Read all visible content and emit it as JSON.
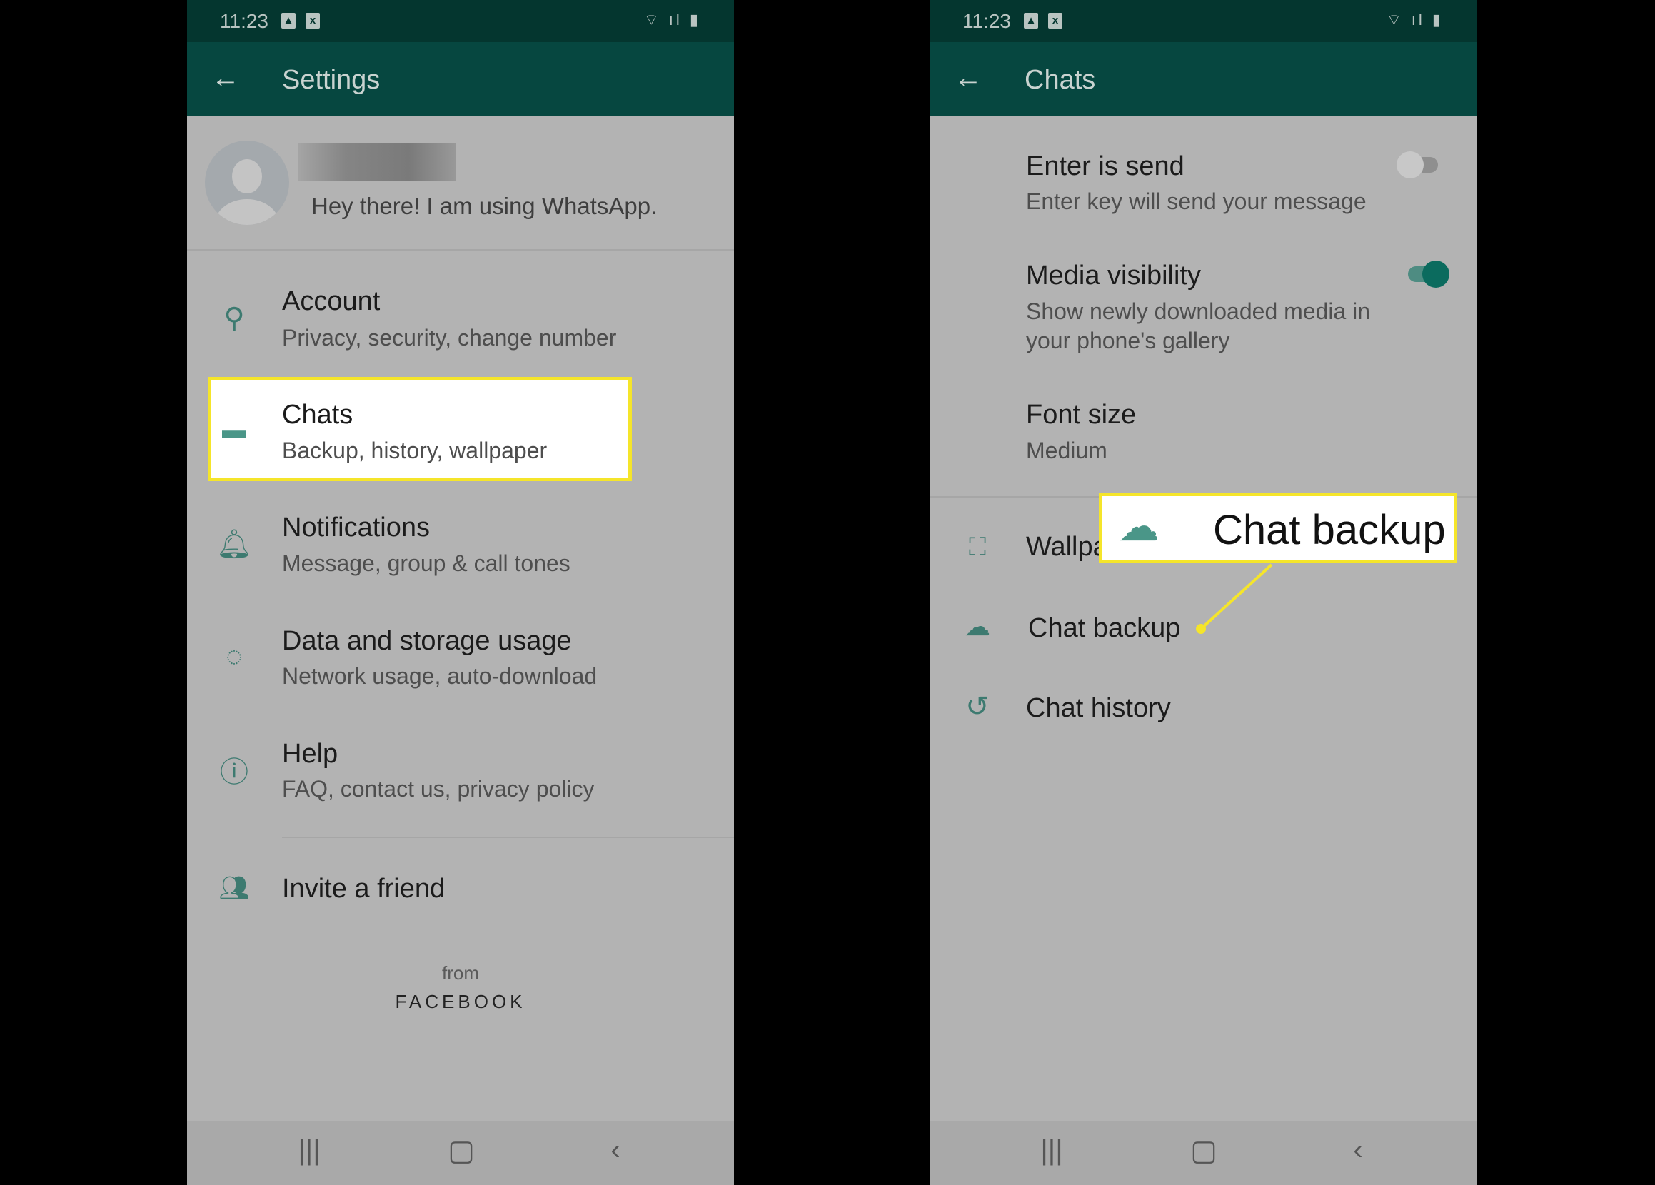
{
  "status_bar": {
    "time": "11:23"
  },
  "left": {
    "title": "Settings",
    "profile": {
      "status": "Hey there! I am using WhatsApp."
    },
    "items": [
      {
        "icon": "key-icon",
        "title": "Account",
        "subtitle": "Privacy, security, change number"
      },
      {
        "icon": "chat-icon",
        "title": "Chats",
        "subtitle": "Backup, history, wallpaper",
        "highlighted": true
      },
      {
        "icon": "bell-icon",
        "title": "Notifications",
        "subtitle": "Message, group & call tones"
      },
      {
        "icon": "data-usage-icon",
        "title": "Data and storage usage",
        "subtitle": "Network usage, auto-download"
      },
      {
        "icon": "help-icon",
        "title": "Help",
        "subtitle": "FAQ, contact us, privacy policy"
      }
    ],
    "invite": "Invite a friend",
    "footer": {
      "from": "from",
      "brand": "FACEBOOK"
    }
  },
  "right": {
    "title": "Chats",
    "enter_send": {
      "title": "Enter is send",
      "subtitle": "Enter key will send your message",
      "on": false
    },
    "media": {
      "title": "Media visibility",
      "subtitle1": "Show newly downloaded media in",
      "subtitle2": "your phone's gallery",
      "on": true
    },
    "font": {
      "title": "Font size",
      "value": "Medium"
    },
    "wallpaper": "Wallpa",
    "backup": "Chat backup",
    "history": "Chat history",
    "callout": "Chat backup"
  },
  "colors": {
    "accent": "#075e54",
    "highlight": "#f5e52a",
    "icon": "#3d7a70"
  }
}
